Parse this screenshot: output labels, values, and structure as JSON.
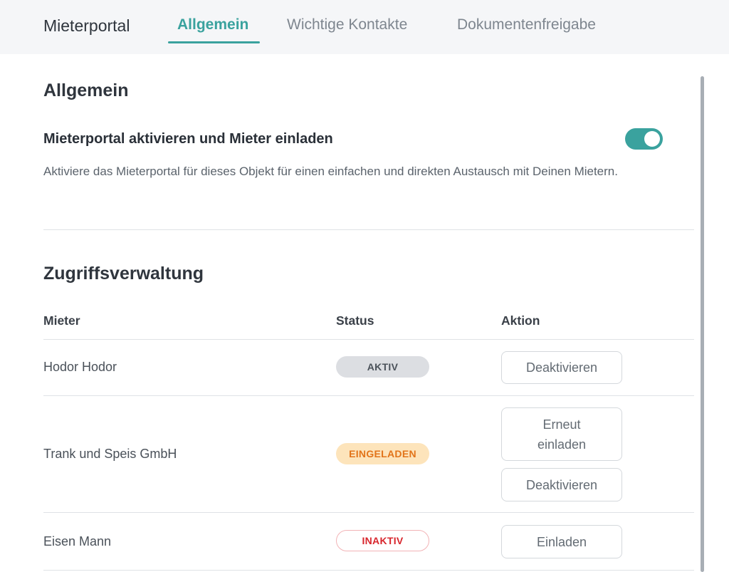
{
  "nav": {
    "brand": "Mieterportal",
    "tabs": [
      {
        "label": "Allgemein",
        "active": true
      },
      {
        "label": "Wichtige Kontakte",
        "active": false
      },
      {
        "label": "Dokumentenfreigabe",
        "active": false
      }
    ]
  },
  "general": {
    "heading": "Allgemein",
    "setting_title": "Mieterportal aktivieren und Mieter einladen",
    "setting_description": "Aktiviere das Mieterportal für dieses Objekt für einen einfachen und direkten Austausch mit Deinen Mietern.",
    "toggle_on": true
  },
  "access": {
    "heading": "Zugriffsverwaltung",
    "columns": [
      "Mieter",
      "Status",
      "Aktion"
    ],
    "rows": [
      {
        "name": "Hodor Hodor",
        "status": "AKTIV",
        "actions": [
          "Deaktivieren"
        ]
      },
      {
        "name": "Trank und Speis GmbH",
        "status": "EINGELADEN",
        "actions": [
          "Erneut einladen",
          "Deaktivieren"
        ]
      },
      {
        "name": "Eisen Mann",
        "status": "INAKTIV",
        "actions": [
          "Einladen"
        ]
      }
    ]
  },
  "colors": {
    "accent": "#3aa29e",
    "badge_active_bg": "#dcdee2",
    "badge_invited_bg": "#fde4bb",
    "badge_invited_text": "#e2741a",
    "badge_inactive_text": "#d8262d"
  }
}
